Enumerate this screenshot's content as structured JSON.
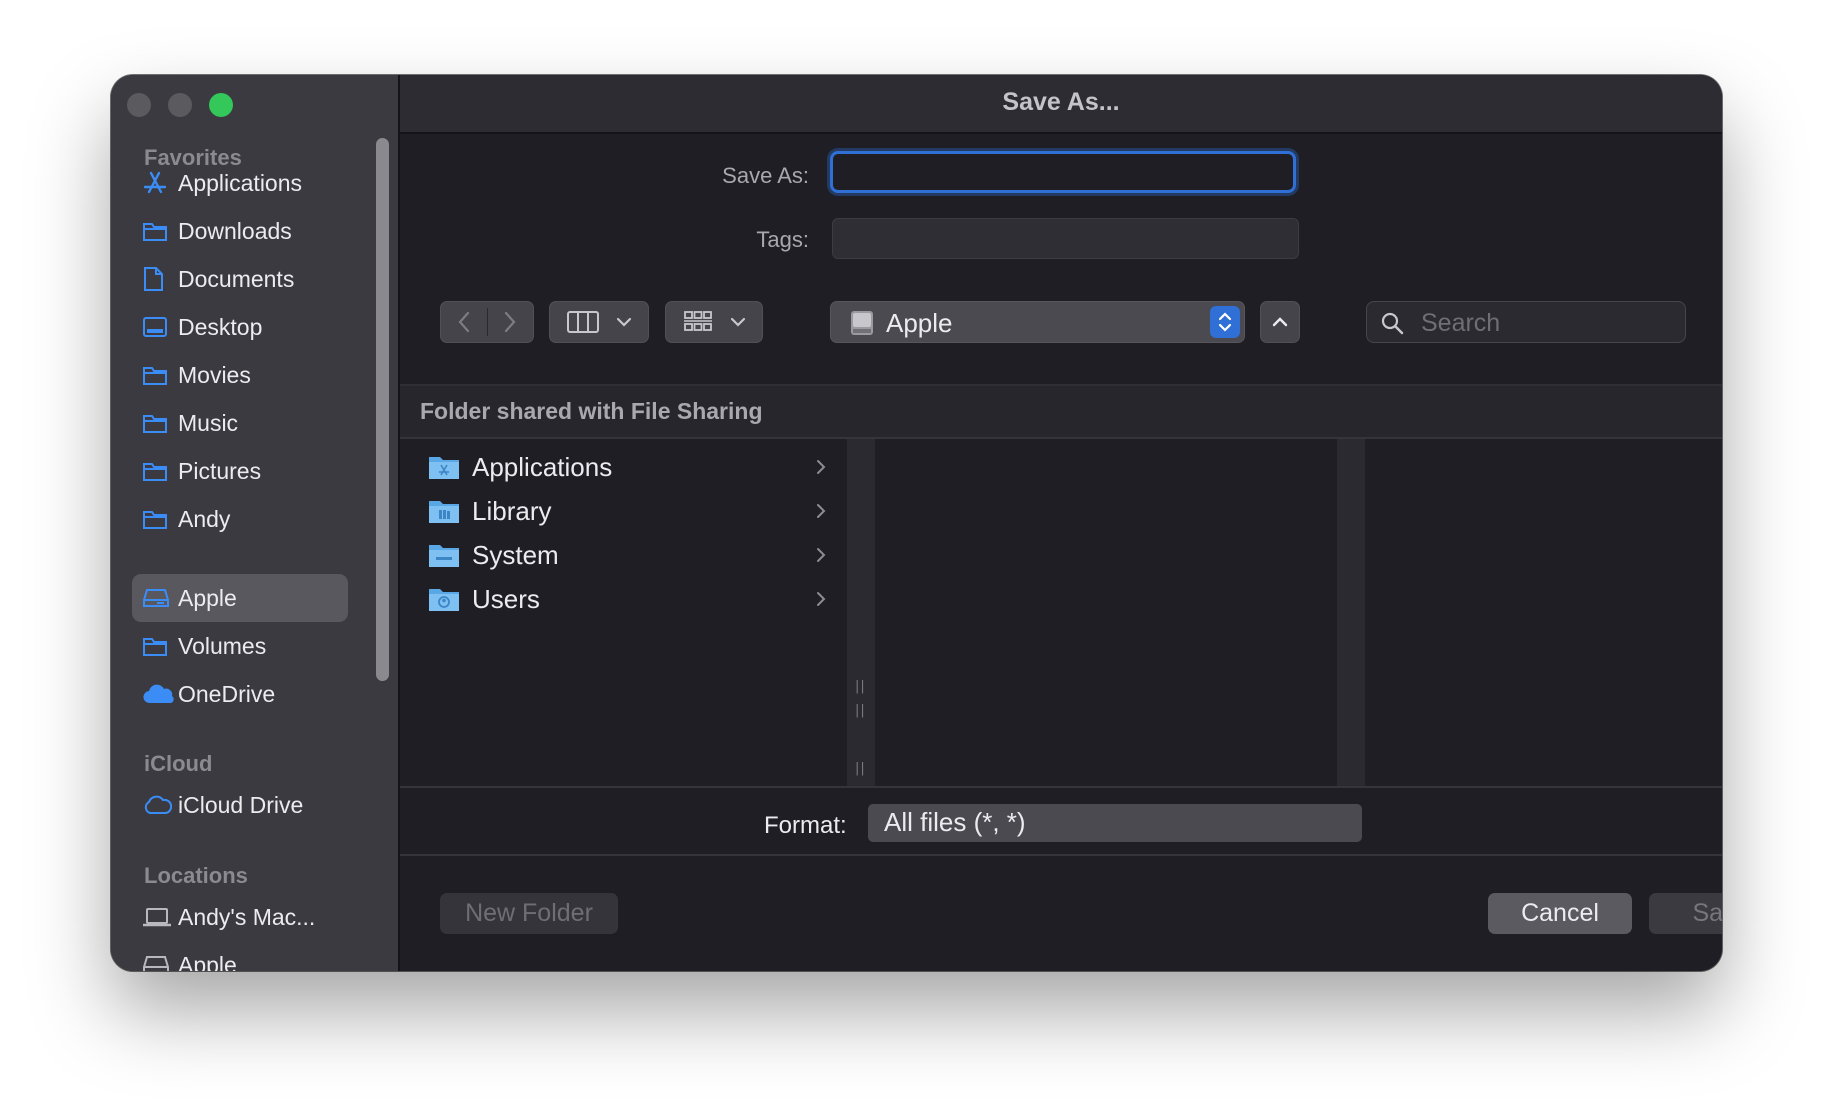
{
  "window": {
    "title": "Save As..."
  },
  "sidebar": {
    "sections": {
      "favorites": "Favorites",
      "icloud": "iCloud",
      "locations": "Locations"
    },
    "favorites": [
      {
        "label": "Applications",
        "icon": "applications-icon"
      },
      {
        "label": "Downloads",
        "icon": "folder-icon"
      },
      {
        "label": "Documents",
        "icon": "document-icon"
      },
      {
        "label": "Desktop",
        "icon": "desktop-icon"
      },
      {
        "label": "Movies",
        "icon": "folder-icon"
      },
      {
        "label": "Music",
        "icon": "folder-icon"
      },
      {
        "label": "Pictures",
        "icon": "folder-icon"
      },
      {
        "label": "Andy",
        "icon": "folder-icon"
      },
      {
        "label": "Apple",
        "icon": "drive-icon",
        "selected": true
      },
      {
        "label": "Volumes",
        "icon": "folder-icon"
      },
      {
        "label": "OneDrive",
        "icon": "onedrive-cloud-icon"
      }
    ],
    "icloud": [
      {
        "label": "iCloud Drive",
        "icon": "icloud-icon"
      }
    ],
    "locations": [
      {
        "label": "Andy's Mac...",
        "icon": "laptop-icon"
      },
      {
        "label": "Apple",
        "icon": "drive-icon"
      }
    ]
  },
  "form": {
    "save_as_label": "Save As:",
    "save_as_value": "",
    "tags_label": "Tags:",
    "tags_value": ""
  },
  "toolbar": {
    "location": "Apple",
    "search_placeholder": "Search"
  },
  "browser": {
    "header": "Folder shared with File Sharing",
    "items": [
      {
        "label": "Applications",
        "icon": "applications-folder-icon"
      },
      {
        "label": "Library",
        "icon": "library-folder-icon"
      },
      {
        "label": "System",
        "icon": "system-folder-icon"
      },
      {
        "label": "Users",
        "icon": "users-folder-icon"
      }
    ]
  },
  "format": {
    "label": "Format:",
    "value": "All files (*, *)"
  },
  "buttons": {
    "new_folder": "New Folder",
    "cancel": "Cancel",
    "save": "Save"
  },
  "colors": {
    "accent": "#2f6fd6",
    "sidebar_icon": "#3b8df5",
    "zoom_button": "#34c759"
  }
}
